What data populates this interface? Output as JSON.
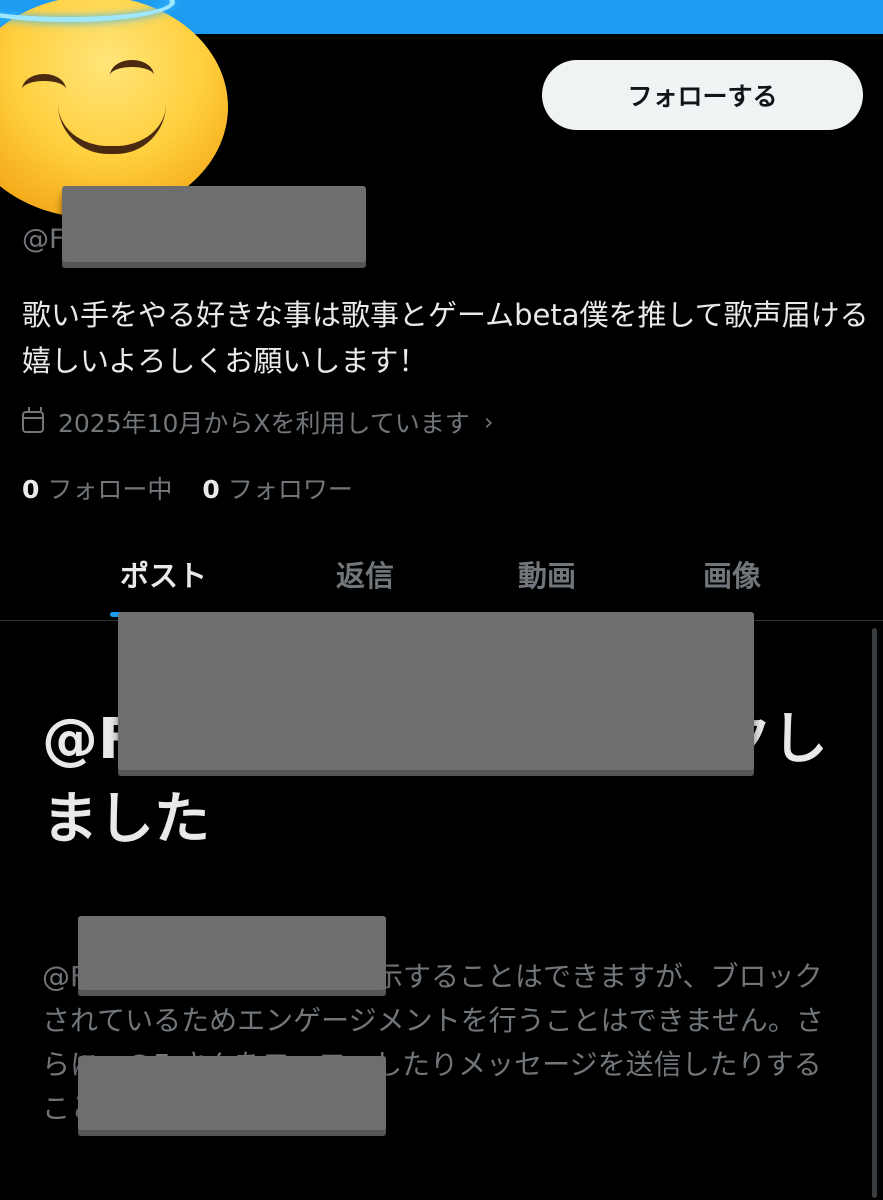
{
  "header": {
    "banner_color": "#1d9bf0",
    "avatar_icon": "smiling-face-with-halo-emoji"
  },
  "profile": {
    "follow_button_label": "フォローする",
    "handle_prefix": "@F",
    "bio": "歌い手をやる好きな事は歌事とゲームbeta僕を推して歌声届ける嬉しいよろしくお願いします！",
    "joined_text": "2025年10月からXを利用しています",
    "following_count": "0",
    "following_label": "フォロー中",
    "followers_count": "0",
    "followers_label": "フォロワー"
  },
  "tabs": [
    {
      "label": "ポスト",
      "active": true
    },
    {
      "label": "返信",
      "active": false
    },
    {
      "label": "動画",
      "active": false
    },
    {
      "label": "画像",
      "active": false
    }
  ],
  "blocked_notice": {
    "title": "@F さんはあなたをブロックしました",
    "body": "@F さんの公開ポストを表示することはできますが、ブロックされているためエンゲージメントを行うことはできません。さらに、@F さんをフォローしたりメッセージを送信したりすることもできません。"
  },
  "colors": {
    "accent": "#1d9bf0",
    "background": "#000000",
    "text_primary": "#e7e9ea",
    "text_secondary": "#71767b"
  }
}
